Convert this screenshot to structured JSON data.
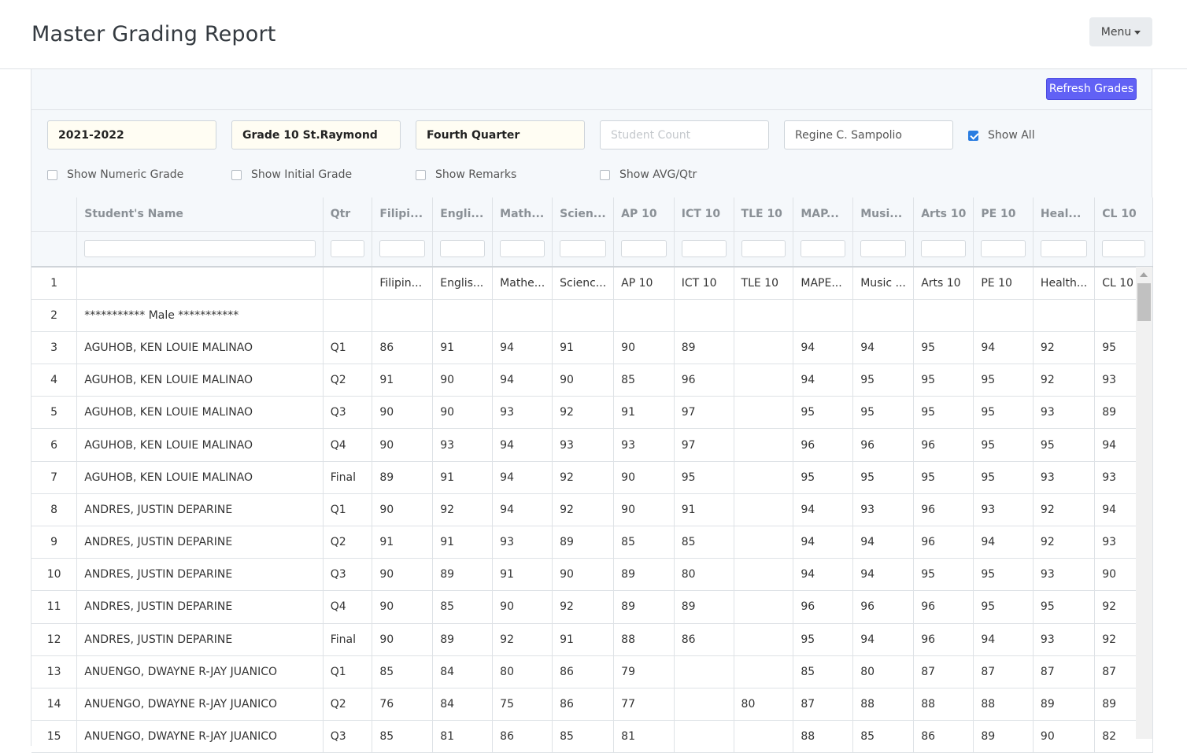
{
  "page": {
    "title": "Master Grading Report",
    "menu_label": "Menu"
  },
  "toolbar": {
    "refresh_label": "Refresh Grades"
  },
  "filters": {
    "school_year": "2021-2022",
    "section": "Grade 10 St.Raymond",
    "quarter": "Fourth Quarter",
    "student_count_placeholder": "Student Count",
    "teacher": "Regine C. Sampolio",
    "show_all_label": "Show All",
    "show_all_checked": true,
    "show_numeric_label": "Show Numeric Grade",
    "show_initial_label": "Show Initial Grade",
    "show_remarks_label": "Show Remarks",
    "show_avg_label": "Show AVG/Qtr"
  },
  "table": {
    "columns": [
      "",
      "Student's Name",
      "Qtr",
      "Filipi...",
      "Engli...",
      "Math...",
      "Scien...",
      "AP 10",
      "ICT 10",
      "TLE 10",
      "MAP...",
      "Musi...",
      "Arts 10",
      "PE 10",
      "Heal...",
      "CL 10"
    ],
    "rows": [
      [
        "1",
        "",
        "",
        "Filipin...",
        "Englis...",
        "Mathe...",
        "Scienc...",
        "AP 10",
        "ICT 10",
        "TLE 10",
        "MAPE...",
        "Music ...",
        "Arts 10",
        "PE 10",
        "Health...",
        "CL 10"
      ],
      [
        "2",
        "*********** Male ***********",
        "",
        "",
        "",
        "",
        "",
        "",
        "",
        "",
        "",
        "",
        "",
        "",
        "",
        ""
      ],
      [
        "3",
        "AGUHOB, KEN LOUIE MALINAO",
        "Q1",
        "86",
        "91",
        "94",
        "91",
        "90",
        "89",
        "",
        "94",
        "94",
        "95",
        "94",
        "92",
        "95"
      ],
      [
        "4",
        "AGUHOB, KEN LOUIE MALINAO",
        "Q2",
        "91",
        "90",
        "94",
        "90",
        "85",
        "96",
        "",
        "94",
        "95",
        "95",
        "95",
        "92",
        "93"
      ],
      [
        "5",
        "AGUHOB, KEN LOUIE MALINAO",
        "Q3",
        "90",
        "90",
        "93",
        "92",
        "91",
        "97",
        "",
        "95",
        "95",
        "95",
        "95",
        "93",
        "89"
      ],
      [
        "6",
        "AGUHOB, KEN LOUIE MALINAO",
        "Q4",
        "90",
        "93",
        "94",
        "93",
        "93",
        "97",
        "",
        "96",
        "96",
        "96",
        "95",
        "95",
        "94"
      ],
      [
        "7",
        "AGUHOB, KEN LOUIE MALINAO",
        "Final",
        "89",
        "91",
        "94",
        "92",
        "90",
        "95",
        "",
        "95",
        "95",
        "95",
        "95",
        "93",
        "93"
      ],
      [
        "8",
        "ANDRES, JUSTIN DEPARINE",
        "Q1",
        "90",
        "92",
        "94",
        "92",
        "90",
        "91",
        "",
        "94",
        "93",
        "96",
        "93",
        "92",
        "94"
      ],
      [
        "9",
        "ANDRES, JUSTIN DEPARINE",
        "Q2",
        "91",
        "91",
        "93",
        "89",
        "85",
        "85",
        "",
        "94",
        "94",
        "96",
        "94",
        "92",
        "93"
      ],
      [
        "10",
        "ANDRES, JUSTIN DEPARINE",
        "Q3",
        "90",
        "89",
        "91",
        "90",
        "89",
        "80",
        "",
        "94",
        "94",
        "95",
        "95",
        "93",
        "90"
      ],
      [
        "11",
        "ANDRES, JUSTIN DEPARINE",
        "Q4",
        "90",
        "85",
        "90",
        "92",
        "89",
        "89",
        "",
        "96",
        "96",
        "96",
        "95",
        "95",
        "92"
      ],
      [
        "12",
        "ANDRES, JUSTIN DEPARINE",
        "Final",
        "90",
        "89",
        "92",
        "91",
        "88",
        "86",
        "",
        "95",
        "94",
        "96",
        "94",
        "93",
        "92"
      ],
      [
        "13",
        "ANUENGO, DWAYNE R-JAY JUANICO",
        "Q1",
        "85",
        "84",
        "80",
        "86",
        "79",
        "",
        "",
        "85",
        "80",
        "87",
        "87",
        "87",
        "87"
      ],
      [
        "14",
        "ANUENGO, DWAYNE R-JAY JUANICO",
        "Q2",
        "76",
        "84",
        "75",
        "86",
        "77",
        "",
        "80",
        "87",
        "88",
        "88",
        "88",
        "89",
        "89"
      ],
      [
        "15",
        "ANUENGO, DWAYNE R-JAY JUANICO",
        "Q3",
        "85",
        "81",
        "86",
        "85",
        "81",
        "",
        "",
        "88",
        "85",
        "86",
        "89",
        "90",
        "82"
      ]
    ]
  }
}
